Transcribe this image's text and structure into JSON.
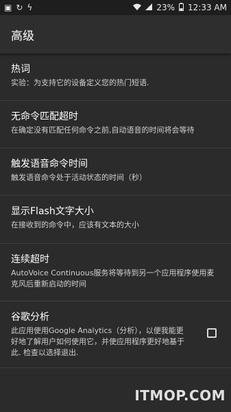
{
  "status_bar": {
    "left_icons": [
      "image-icon",
      "sync-icon",
      "flash-icon"
    ],
    "battery_percent": "23%",
    "time": "12:33 AM"
  },
  "app_bar": {
    "title": "高级"
  },
  "settings": [
    {
      "title": "热词",
      "subtitle": "实验：为支持它的设备定义您的热门短语."
    },
    {
      "title": "无命令匹配超时",
      "subtitle": "在确定没有匹配任何命令之前,自动语音的时间将会等待"
    },
    {
      "title": "触发语音命令时间",
      "subtitle": "触发语音命令处于活动状态的时间（秒）"
    },
    {
      "title": "显示Flash文字大小",
      "subtitle": "在接收到的命令中，应该有文本的大小"
    },
    {
      "title": "连续超时",
      "subtitle": "AutoVoice Continuous服务将等待到另一个应用程序使用麦克风后重新启动的时间"
    },
    {
      "title": "谷歌分析",
      "subtitle": "此应用使用Google Analytics（分析），以便我能更好地了解用户如何使用它，并使应用程序更好地基于此. 检查以选择退出.",
      "checked": false
    }
  ],
  "watermark": "ITMOP.COM"
}
